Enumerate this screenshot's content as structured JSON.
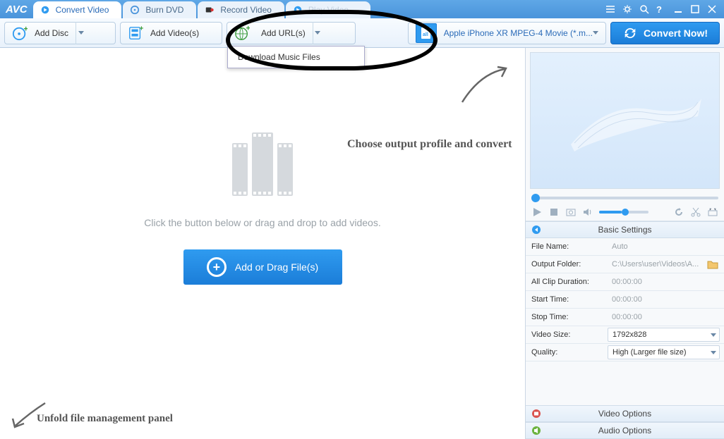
{
  "app": {
    "logo": "AVC"
  },
  "tabs": {
    "convert": "Convert Video",
    "burn": "Burn DVD",
    "record": "Record Video",
    "play": "Play Video"
  },
  "toolbar": {
    "add_disc": "Add Disc",
    "add_videos": "Add Video(s)",
    "add_urls": "Add URL(s)",
    "profile": "Apple iPhone XR MPEG-4 Movie (*.m...",
    "convert": "Convert Now!"
  },
  "url_menu": {
    "download_music": "Download Music Files"
  },
  "main": {
    "hint": "Click the button below or drag and drop to add videos.",
    "add_btn": "Add or Drag File(s)"
  },
  "preview": {},
  "settings": {
    "header": "Basic Settings",
    "rows": {
      "filename_lbl": "File Name:",
      "filename_val": "Auto",
      "output_lbl": "Output Folder:",
      "output_val": "C:\\Users\\user\\Videos\\A...",
      "duration_lbl": "All Clip Duration:",
      "duration_val": "00:00:00",
      "start_lbl": "Start Time:",
      "start_val": "00:00:00",
      "stop_lbl": "Stop Time:",
      "stop_val": "00:00:00",
      "size_lbl": "Video Size:",
      "size_val": "1792x828",
      "quality_lbl": "Quality:",
      "quality_val": "High (Larger file size)"
    },
    "video_opts": "Video Options",
    "audio_opts": "Audio Options"
  },
  "annotations": {
    "profile_hint": "Choose output profile and convert",
    "unfold_hint": "Unfold file management panel"
  }
}
